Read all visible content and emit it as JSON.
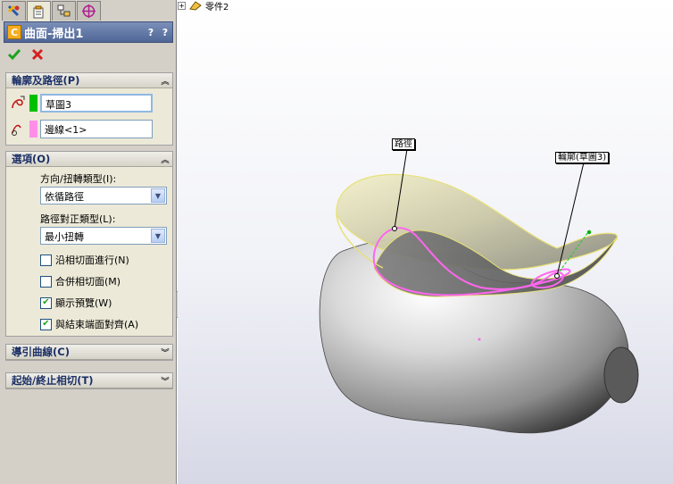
{
  "panel": {
    "tabs": [
      {
        "name": "feature-manager-tab",
        "icon": "feature-tree-icon"
      },
      {
        "name": "property-manager-tab",
        "icon": "property-icon"
      },
      {
        "name": "configuration-manager-tab",
        "icon": "configuration-icon"
      },
      {
        "name": "dimxpert-tab",
        "icon": "target-icon"
      }
    ],
    "title": "曲面-掃出1",
    "title_icon": "C",
    "help_label": "?",
    "pin_label": "?",
    "ok_icon": "checkmark-icon",
    "cancel_icon": "x-icon"
  },
  "profile_path": {
    "header": "輪廓及路徑(P)",
    "profile_value": "草圖3",
    "profile_color": "#00c000",
    "path_value": "邊線<1>",
    "path_color": "#ff8ee8"
  },
  "options": {
    "header": "選項(O)",
    "orientation_label": "方向/扭轉類型(I):",
    "orientation_value": "依循路徑",
    "alignment_label": "路徑對正類型(L):",
    "alignment_value": "最小扭轉",
    "checkboxes": [
      {
        "label": "沿相切面進行(N)",
        "checked": false
      },
      {
        "label": "合併相切面(M)",
        "checked": false
      },
      {
        "label": "顯示預覽(W)",
        "checked": true
      },
      {
        "label": "與結束端面對齊(A)",
        "checked": true
      }
    ]
  },
  "guide_curves": {
    "header": "導引曲線(C)"
  },
  "start_end": {
    "header": "起始/終止相切(T)"
  },
  "viewport": {
    "tree_label": "零件2",
    "callout_path": "路徑",
    "callout_profile": "輪廓(草圖3)",
    "accent_pink": "#ff66ee",
    "accent_yellow": "#e8e070"
  }
}
